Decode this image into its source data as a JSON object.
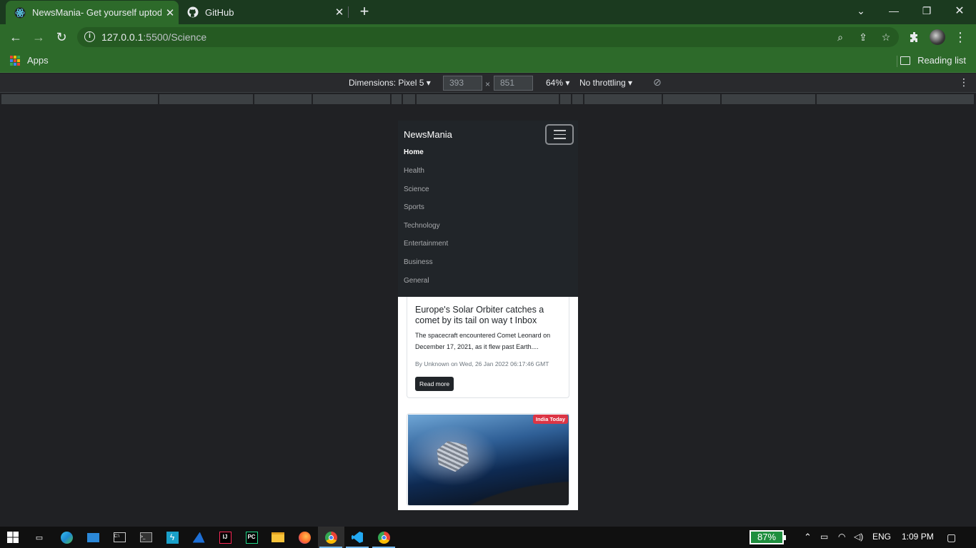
{
  "browser": {
    "tabs": [
      {
        "title": "NewsMania- Get yourself uptoda",
        "active": true
      },
      {
        "title": "GitHub",
        "active": false
      }
    ],
    "url_host": "127.0.0.1",
    "url_path": ":5500/Science",
    "bookmarks": {
      "apps_label": "Apps",
      "reading_list_label": "Reading list"
    }
  },
  "devtools": {
    "dimensions_label": "Dimensions: Pixel 5",
    "width": "393",
    "height": "851",
    "zoom": "64%",
    "throttling": "No throttling"
  },
  "site": {
    "brand": "NewsMania",
    "nav": [
      "Home",
      "Health",
      "Science",
      "Sports",
      "Technology",
      "Entertainment",
      "Business",
      "General"
    ],
    "active_nav": "Home",
    "card1": {
      "title": "Europe's Solar Orbiter catches a comet by its tail on way t Inbox",
      "text": "The spacecraft encountered Comet Leonard on December 17, 2021, as it flew past Earth....",
      "meta": "By Unknown on Wed, 26 Jan 2022 06:17:46 GMT",
      "button": "Read more"
    },
    "card2": {
      "source_badge": "India Today"
    }
  },
  "taskbar": {
    "battery": "87%",
    "language": "ENG",
    "time": "1:09 PM"
  },
  "colors": {
    "browser_theme": "#2d6a2a",
    "tab_strip": "#1b3a1f",
    "navbar": "#212529",
    "badge": "#dc3545"
  }
}
